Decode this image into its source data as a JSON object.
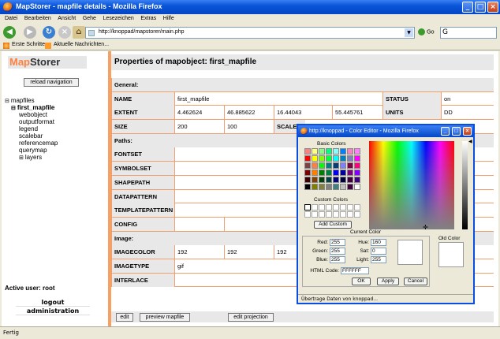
{
  "window": {
    "title": "MapStorer - mapfile details - Mozilla Firefox"
  },
  "menu": [
    "Datei",
    "Bearbeiten",
    "Ansicht",
    "Gehe",
    "Lesezeichen",
    "Extras",
    "Hilfe"
  ],
  "nav": {
    "url": "http://knoppad/mapstorer/main.php",
    "go_label": "Go"
  },
  "bookmarks": [
    "Erste Schritte",
    "Aktuelle Nachrichten..."
  ],
  "sidebar": {
    "logo_prefix": "Map",
    "logo_suffix": "Storer",
    "reload_label": "reload navigation",
    "tree": [
      "mapfiles",
      "first_mapfile",
      "webobject",
      "outputformat",
      "legend",
      "scalebar",
      "referencemap",
      "querymap",
      "layers"
    ],
    "active_user": "Active user: root",
    "logout": "logout",
    "administration": "administration"
  },
  "main": {
    "title": "Properties of mapobject: first_mapfile",
    "general": "General:",
    "name_label": "NAME",
    "name_value": "first_mapfile",
    "status_label": "STATUS",
    "status_value": "on",
    "extent_label": "EXTENT",
    "extent": [
      "4.462624",
      "46.885622",
      "16.44043",
      "55.445761"
    ],
    "units_label": "UNITS",
    "units_value": "DD",
    "size_label": "SIZE",
    "size": [
      "200",
      "100"
    ],
    "scale_label": "SCALE",
    "paths": "Paths:",
    "fontset": "FONTSET",
    "symbolset": "SYMBOLSET",
    "shapepath": "SHAPEPATH",
    "datapattern": "DATAPATTERN",
    "templatepattern": "TEMPLATEPATTERN",
    "config": "CONFIG",
    "image": "Image:",
    "imagecolor_label": "IMAGECOLOR",
    "imagecolor": [
      "192",
      "192",
      "192"
    ],
    "imagetype_label": "IMAGETYPE",
    "imagetype_value": "gif",
    "interlace_label": "INTERLACE",
    "edit_label": "edit",
    "preview_label": "preview mapfile",
    "projection_label": "edit projection"
  },
  "dialog": {
    "title": "http://knoppad - Color Editor - Mozilla Firefox",
    "basic_colors": "Basic Colors",
    "custom_colors": "Custom Colors",
    "add_custom": "Add Custom",
    "current_color": "Current Color",
    "old_color": "Old Color",
    "red_label": "Red:",
    "red": "255",
    "green_label": "Green:",
    "green": "255",
    "blue_label": "Blue:",
    "blue": "255",
    "hue_label": "Hue:",
    "hue": "160",
    "sat_label": "Sat:",
    "sat": "0",
    "light_label": "Light:",
    "light": "255",
    "html_label": "HTML Code:",
    "html": "FFFFFF",
    "ok": "OK",
    "apply": "Apply",
    "cancel": "Cancel",
    "status": "Übertrage Daten von knoppad...",
    "basic_palette": [
      "#ff8080",
      "#ffff80",
      "#80ff80",
      "#00ff80",
      "#80ffff",
      "#0080ff",
      "#ff80c0",
      "#ff80ff",
      "#ff0000",
      "#ffff00",
      "#80ff00",
      "#00ff40",
      "#00ffff",
      "#0080c0",
      "#8080c0",
      "#ff00ff",
      "#804040",
      "#ff8040",
      "#00ff00",
      "#008080",
      "#004080",
      "#8080ff",
      "#800040",
      "#ff0080",
      "#800000",
      "#ff8000",
      "#008000",
      "#008040",
      "#0000ff",
      "#0000a0",
      "#800080",
      "#8000ff",
      "#400000",
      "#804000",
      "#004000",
      "#004040",
      "#000080",
      "#000040",
      "#400040",
      "#400080",
      "#000000",
      "#808000",
      "#808040",
      "#808080",
      "#408080",
      "#c0c0c0",
      "#400040",
      "#ffffff"
    ]
  },
  "statusbar": "Fertig"
}
